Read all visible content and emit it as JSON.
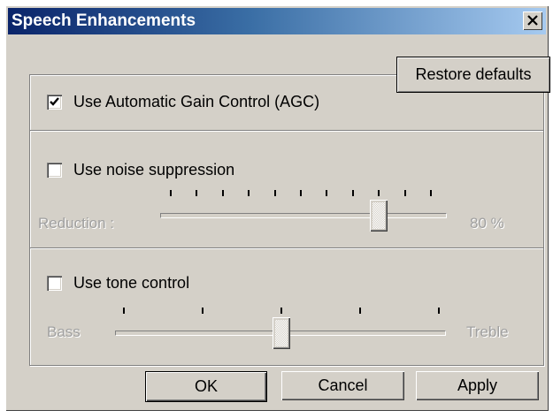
{
  "window": {
    "title": "Speech Enhancements",
    "close_label": "×"
  },
  "restore_defaults": "Restore defaults",
  "agc": {
    "label": "Use Automatic Gain Control (AGC)",
    "checked": true
  },
  "noise": {
    "label": "Use noise suppression",
    "checked": false,
    "reduction_label": "Reduction :",
    "value_text": "80 %",
    "slider_fraction": 0.8
  },
  "tone": {
    "label": "Use tone control",
    "checked": false,
    "left_label": "Bass",
    "right_label": "Treble",
    "slider_fraction": 0.5
  },
  "buttons": {
    "ok": "OK",
    "cancel": "Cancel",
    "apply": "Apply"
  },
  "icons": {
    "close": "close-icon",
    "check": "checkmark-icon"
  }
}
